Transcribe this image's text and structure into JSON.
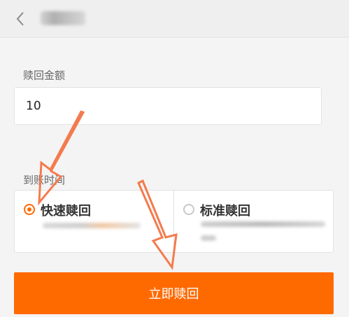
{
  "header": {
    "back_icon": "chevron-left-icon",
    "title": ""
  },
  "form": {
    "amount_label": "赎回金额",
    "amount_value": "10",
    "arrival_label": "到账时间",
    "options": [
      {
        "label": "快速赎回",
        "selected": true
      },
      {
        "label": "标准赎回",
        "selected": false
      }
    ]
  },
  "actions": {
    "redeem_label": "立即赎回"
  },
  "colors": {
    "accent": "#ff6a00",
    "annotation_arrow": "#f37b4e"
  }
}
